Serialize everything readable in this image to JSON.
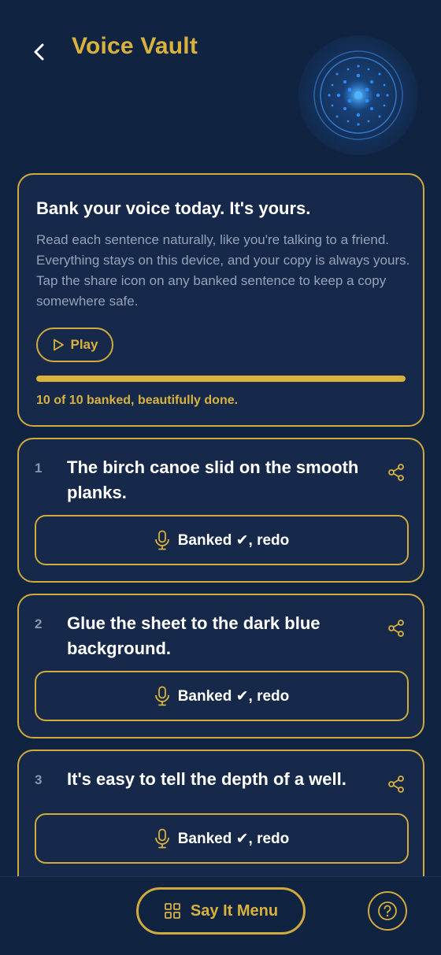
{
  "header": {
    "title": "Voice Vault"
  },
  "intro": {
    "title": "Bank your voice today. It's yours.",
    "body": "Read each sentence naturally, like you're talking to a friend. Everything stays on this device, and your copy is always yours. Tap the share icon on any banked sentence to keep a copy somewhere safe.",
    "play_label": "Play",
    "progress_fraction": 1.0,
    "progress_text": "10 of 10 banked, beautifully done."
  },
  "sentences": [
    {
      "number": "1",
      "text": "The birch canoe slid on the smooth planks.",
      "button_label": "Banked ✔, redo"
    },
    {
      "number": "2",
      "text": "Glue the sheet to the dark blue background.",
      "button_label": "Banked ✔, redo"
    },
    {
      "number": "3",
      "text": "It's easy to tell the depth of a well.",
      "button_label": "Banked ✔, redo"
    }
  ],
  "footer": {
    "menu_label": "Say It Menu"
  },
  "colors": {
    "background": "#102441",
    "card": "#16294a",
    "accent": "#d9b23e",
    "muted": "#93a3b9"
  }
}
